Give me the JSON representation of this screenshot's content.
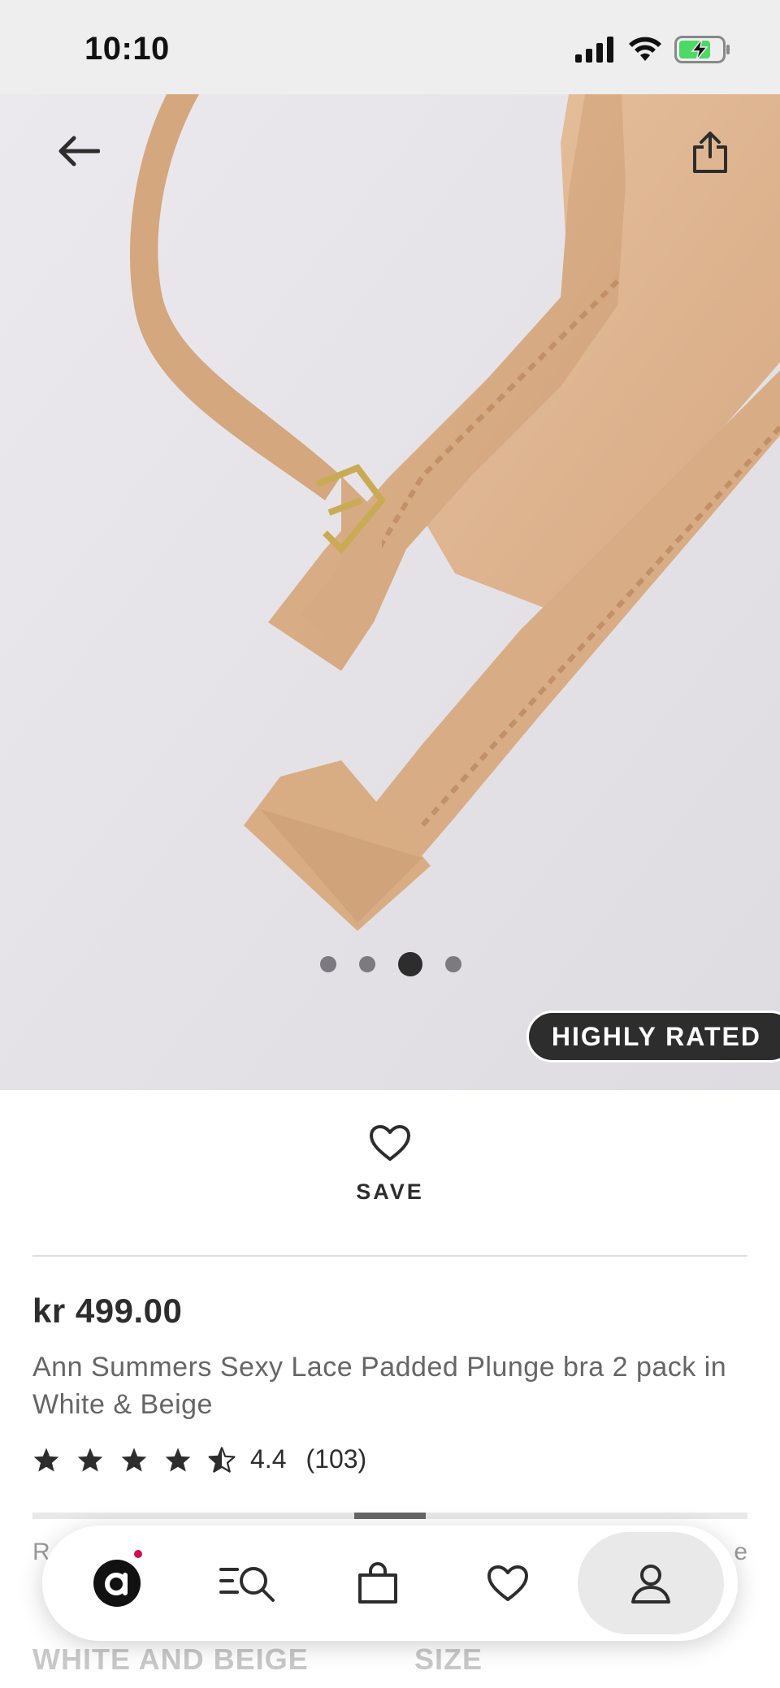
{
  "status_bar": {
    "time": "10:10"
  },
  "hero": {
    "pagination": {
      "total": 4,
      "active_index": 3
    },
    "badge": "HIGHLY RATED"
  },
  "save": {
    "label": "SAVE"
  },
  "product": {
    "price": "kr 499.00",
    "title": "Ann Summers Sexy Lace Padded Plunge bra 2 pack in White & Beige",
    "rating": {
      "value": "4.4",
      "count": "(103)",
      "stars": 4.5
    }
  },
  "underlay": {
    "row1_left": "R",
    "row1_right": "e",
    "row2_color": "WHITE AND BEIGE",
    "row2_size": "SIZE"
  },
  "nav": {
    "items": [
      "home-icon",
      "search-icon",
      "bag-icon",
      "heart-icon",
      "account-icon"
    ],
    "active": "account-icon"
  },
  "colors": {
    "brand_dark": "#2d2d2d",
    "notification": "#d0114e",
    "status_bg": "#eeeeef",
    "battery_green": "#4cd964"
  }
}
